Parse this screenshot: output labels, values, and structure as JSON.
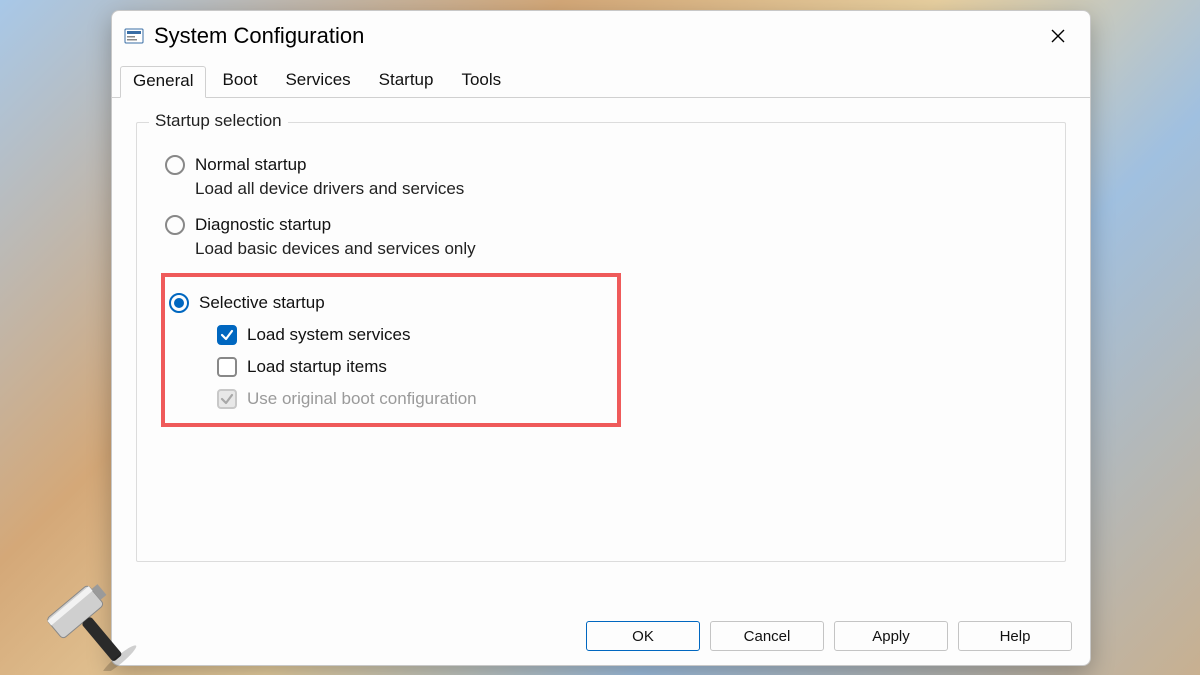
{
  "window": {
    "title": "System Configuration"
  },
  "tabs": {
    "general": "General",
    "boot": "Boot",
    "services": "Services",
    "startup": "Startup",
    "tools": "Tools",
    "active": "General"
  },
  "group": {
    "legend": "Startup selection",
    "normal": {
      "label": "Normal startup",
      "desc": "Load all device drivers and services",
      "selected": false
    },
    "diagnostic": {
      "label": "Diagnostic startup",
      "desc": "Load basic devices and services only",
      "selected": false
    },
    "selective": {
      "label": "Selective startup",
      "selected": true,
      "load_system_services": {
        "label": "Load system services",
        "checked": true,
        "enabled": true
      },
      "load_startup_items": {
        "label": "Load startup items",
        "checked": false,
        "enabled": true
      },
      "use_original_boot": {
        "label": "Use original boot configuration",
        "checked": true,
        "enabled": false
      }
    }
  },
  "buttons": {
    "ok": "OK",
    "cancel": "Cancel",
    "apply": "Apply",
    "help": "Help"
  }
}
